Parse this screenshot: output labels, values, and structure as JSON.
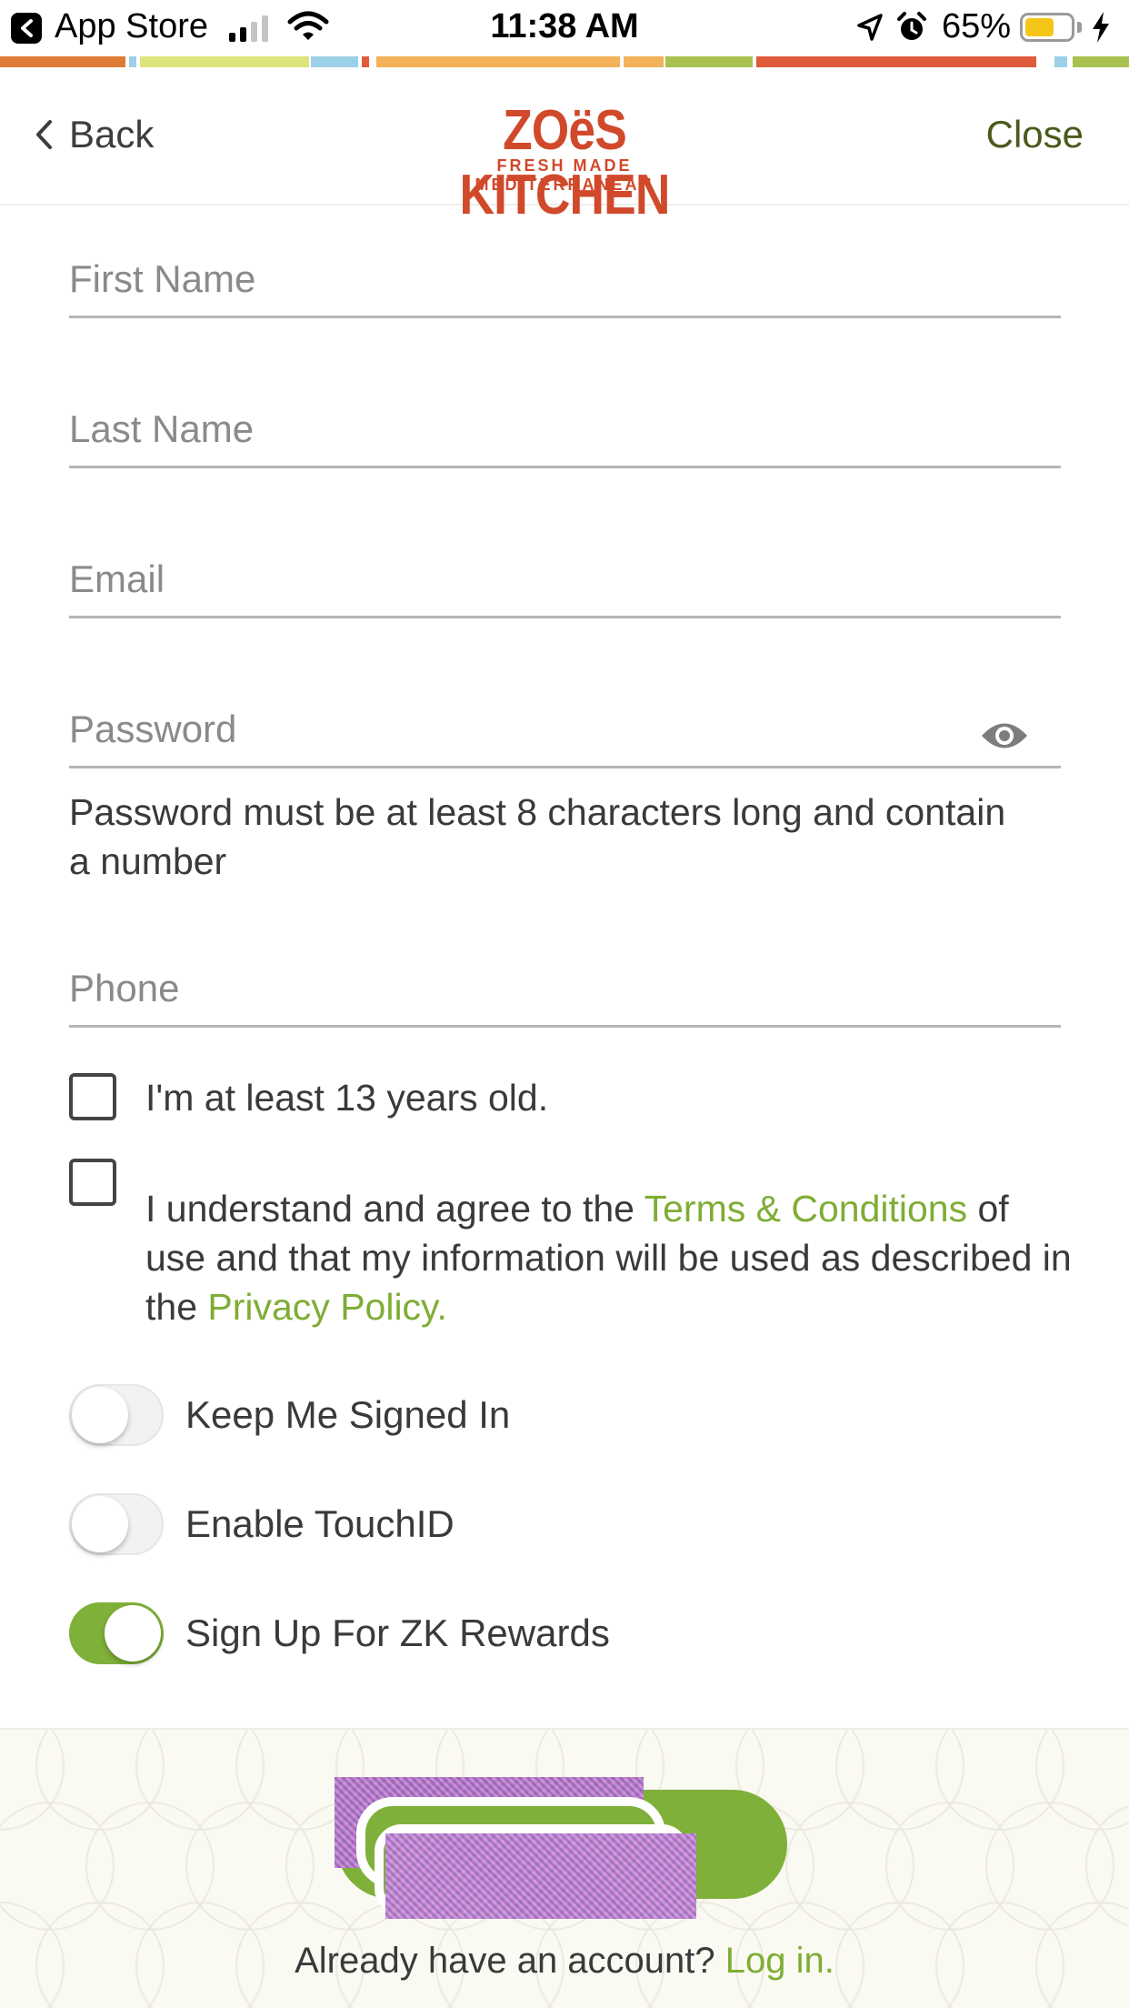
{
  "status_bar": {
    "back_app": "App Store",
    "time": "11:38 AM",
    "battery_percent": "65%",
    "battery_level": 0.65,
    "signal_icon": "signal-bars-icon",
    "wifi_icon": "wifi-icon",
    "location_icon": "location-arrow-icon",
    "alarm_icon": "alarm-clock-icon",
    "charging_icon": "charging-bolt-icon"
  },
  "nav": {
    "back_label": "Back",
    "close_label": "Close",
    "logo_text": "ZOëS KITCHEN",
    "logo_tagline": "FRESH MADE MEDITERRANEAN"
  },
  "form": {
    "first_name": {
      "placeholder": "First Name",
      "value": ""
    },
    "last_name": {
      "placeholder": "Last Name",
      "value": ""
    },
    "email": {
      "placeholder": "Email",
      "value": ""
    },
    "password": {
      "placeholder": "Password",
      "value": "",
      "toggle_icon": "eye-icon"
    },
    "password_hint": "Password must be at least 8 characters long and contain a number",
    "phone": {
      "placeholder": "Phone",
      "value": ""
    }
  },
  "checkboxes": {
    "age": {
      "label": "I'm at least 13 years old.",
      "checked": false
    },
    "terms": {
      "text_before": "I understand and agree to the ",
      "terms_link": "Terms & Conditions",
      "text_middle": " of use and that my information will be used as described in the ",
      "privacy_link": "Privacy Policy.",
      "checked": false
    }
  },
  "toggles": {
    "keep_signed_in": {
      "label": "Keep Me Signed In",
      "on": false
    },
    "touch_id": {
      "label": "Enable TouchID",
      "on": false
    },
    "rewards": {
      "label": "Sign Up For ZK Rewards",
      "on": true
    }
  },
  "footer": {
    "login_prompt": "Already have an account? ",
    "login_link": "Log in."
  },
  "colors": {
    "accent_green": "#7fb03a",
    "brand_red": "#d0492a",
    "close_text": "#4a5a1c"
  }
}
